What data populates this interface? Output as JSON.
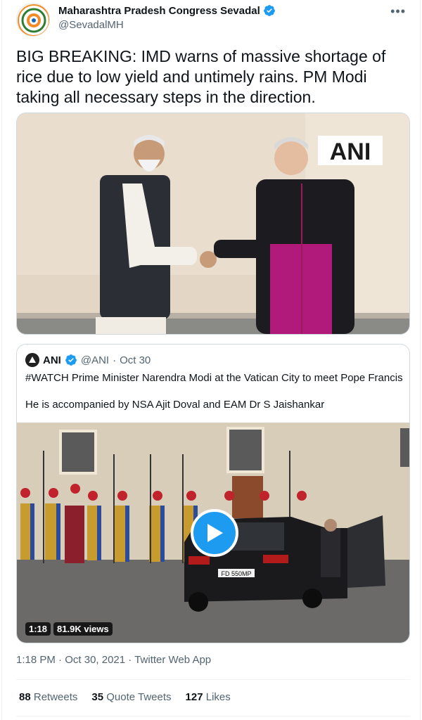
{
  "author": {
    "name": "Maharashtra Pradesh Congress Sevadal",
    "handle": "@SevadalMH"
  },
  "tweet": {
    "text": "BIG BREAKING: IMD warns of massive shortage of rice due to low yield and untimely rains. PM Modi taking all necessary steps in the direction.",
    "image_watermark": "ANI"
  },
  "quoted": {
    "name": "ANI",
    "handle": "@ANI",
    "separator": "·",
    "date": "Oct 30",
    "text_line1": "#WATCH Prime Minister Narendra Modi at the Vatican City to meet Pope Francis",
    "text_line2": "He is accompanied by NSA Ajit Doval and EAM Dr S Jaishankar",
    "video": {
      "duration": "1:18",
      "views": "81.9K views",
      "plate": "FD 550MP"
    }
  },
  "meta": {
    "time": "1:18 PM",
    "sep1": " · ",
    "date": "Oct 30, 2021",
    "sep2": " · ",
    "source": "Twitter Web App"
  },
  "stats": {
    "retweets_count": "88",
    "retweets_label": "Retweets",
    "quotes_count": "35",
    "quotes_label": "Quote Tweets",
    "likes_count": "127",
    "likes_label": "Likes"
  },
  "colors": {
    "accent": "#1d9bf0",
    "text": "#0f1419",
    "secondary": "#536471",
    "border": "#cfd9de"
  },
  "icons": [
    "verified-badge-icon",
    "more-options-icon",
    "play-icon"
  ]
}
